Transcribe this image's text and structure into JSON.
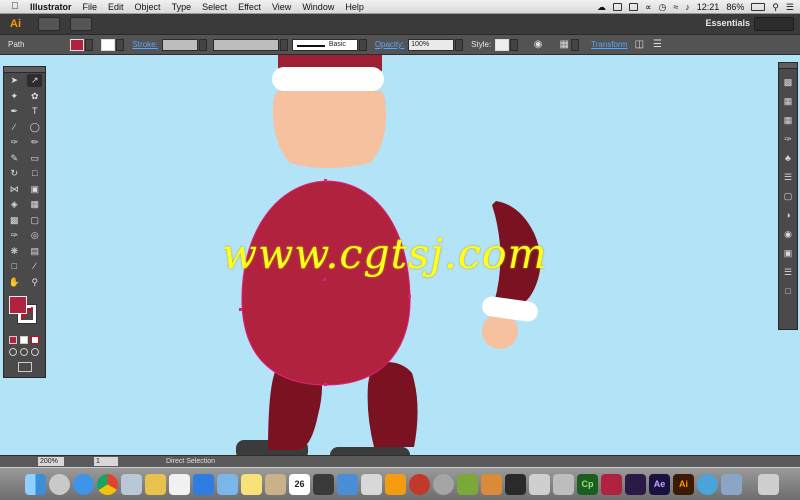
{
  "menubar": {
    "apple": "",
    "items": [
      "Illustrator",
      "File",
      "Edit",
      "Object",
      "Type",
      "Select",
      "Effect",
      "View",
      "Window",
      "Help"
    ],
    "clock": "12:21",
    "battery": "86%"
  },
  "appbar": {
    "logo": "Ai",
    "workspace": "Essentials"
  },
  "controlbar": {
    "selection_type": "Path",
    "stroke_label": "Stroke:",
    "brush_label": "Basic",
    "opacity_label": "Opacity:",
    "opacity_value": "100%",
    "style_label": "Style:",
    "transform_label": "Transform",
    "fill_color": "#b1223f"
  },
  "canvas": {
    "background": "#b3e3f6",
    "colors": {
      "coat": "#b1223f",
      "legs": "#7a1222",
      "skin": "#f5c19e",
      "trim": "#ffffff",
      "boots": "#3b3b3b",
      "hat": "#9c1f34"
    }
  },
  "watermark": "www.cgtsj.com",
  "tools": {
    "fill_color": "#b1223f"
  },
  "statusbar": {
    "zoom": "200%",
    "page": "1",
    "current_tool": "Direct Selection"
  },
  "dock": {
    "calendar_day": "26",
    "captivate": "Cp",
    "after_effects": "Ae",
    "illustrator": "Ai"
  }
}
